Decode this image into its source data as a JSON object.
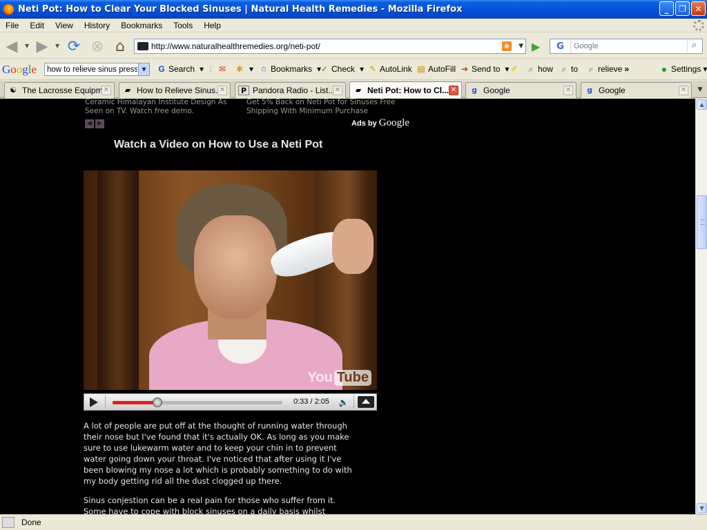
{
  "window": {
    "title": "Neti Pot: How to Clear Your Blocked Sinuses | Natural Health Remedies - Mozilla Firefox",
    "minimize_label": "_",
    "maximize_label": "❐",
    "close_label": "✕"
  },
  "menu": [
    "File",
    "Edit",
    "View",
    "History",
    "Bookmarks",
    "Tools",
    "Help"
  ],
  "navigation": {
    "url": "http://www.naturalhealthremedies.org/neti-pot/",
    "search_engine": "G",
    "search_placeholder": "Google"
  },
  "google_toolbar": {
    "logo": {
      "G": "G",
      "o1": "o",
      "o2": "o",
      "g": "g",
      "l": "l",
      "e": "e"
    },
    "query": "how to relieve sinus pressu",
    "search_label": "Search",
    "bookmarks_label": "Bookmarks",
    "check_label": "Check",
    "autolink_label": "AutoLink",
    "autofill_label": "AutoFill",
    "sendto_label": "Send to",
    "term1": "how",
    "term2": "to",
    "term3": "relieve",
    "more_label": "»",
    "settings_label": "Settings"
  },
  "tabs": [
    {
      "label": "The Lacrosse Equipm...",
      "icon": "lacrosse-site-icon",
      "active": false
    },
    {
      "label": "How to Relieve Sinus...",
      "icon": "site-icon",
      "active": false
    },
    {
      "label": "Pandora Radio - List...",
      "icon": "pandora-icon",
      "active": false
    },
    {
      "label": "Neti Pot: How to Cl...",
      "icon": "site-icon",
      "active": true
    },
    {
      "label": "Google",
      "icon": "google-icon",
      "active": false
    },
    {
      "label": "Google",
      "icon": "google-icon",
      "active": false
    }
  ],
  "page": {
    "ad1": "Ceramic Himalayan Institute Design As Seen on TV. Watch free demo.",
    "ad2": "Get 5% Back on Neti Pot for Sinuses Free Shipping With Minimum Purchase",
    "ads_by": "Ads by",
    "ads_by_brand": "Google",
    "video_heading": "Watch a Video on How to Use a Neti Pot",
    "video": {
      "brand_you": "You",
      "brand_tube": "Tube",
      "time": "0:33 / 2:05",
      "progress_fraction": 0.264
    },
    "paragraph1": "A lot of people are put off at the thought of running water through their nose but I've found that it's actually OK. As long as you make sure to use lukewarm water and to keep your chin in to prevent water going down your throat. I've noticed that after using it I've been blowing my nose a lot which is probably something to do with my body getting rid all the dust clogged up there.",
    "paragraph2": "Sinus conjestion can be a real pain for those who suffer from it. Some have to cope with block sinuses on a daily basis whilst"
  },
  "status": {
    "text": "Done"
  }
}
